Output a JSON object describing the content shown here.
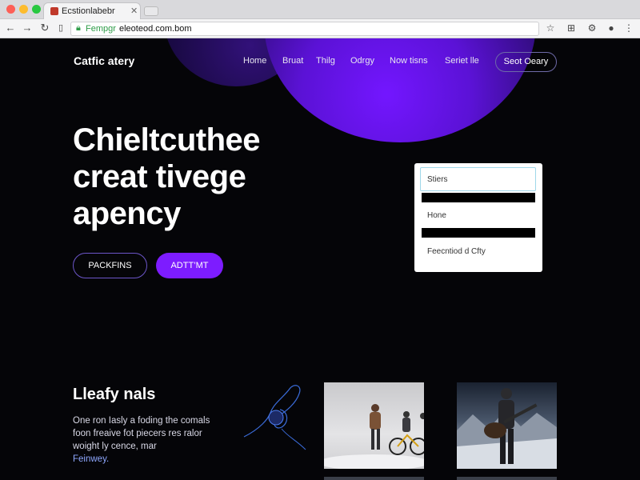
{
  "browser": {
    "tab_title": "Ecstionlabebr",
    "url_scheme": "Fempgr",
    "url_rest": "eleoteod.com.bom"
  },
  "site": {
    "logo": "Catfic atery",
    "nav": [
      "Home",
      "Bruat",
      "Thilg",
      "Odrgy",
      "Now tisns",
      "Seriet lle"
    ],
    "nav_cta": "Seot Oeary",
    "hero_title": [
      "Chieltcuthee",
      "creat tivege",
      "apency"
    ],
    "btn_outline": "PACKFINS",
    "btn_fill": "ADTT’MT",
    "form": {
      "field1_placeholder": "Stiers",
      "label1": "Hone",
      "label2": "Feecntiod d Cfty"
    },
    "section": {
      "title": "Lleafy nals",
      "body_lines": [
        "One ron Iasly a foding the comals",
        "foon freaive fot piecers res ralor",
        "woight ly cence,  mar"
      ],
      "body_highlight": "Feinwey."
    }
  },
  "colors": {
    "accent": "#7d1cff",
    "orb": "#5b12d6",
    "url_green": "#2e9c48"
  }
}
